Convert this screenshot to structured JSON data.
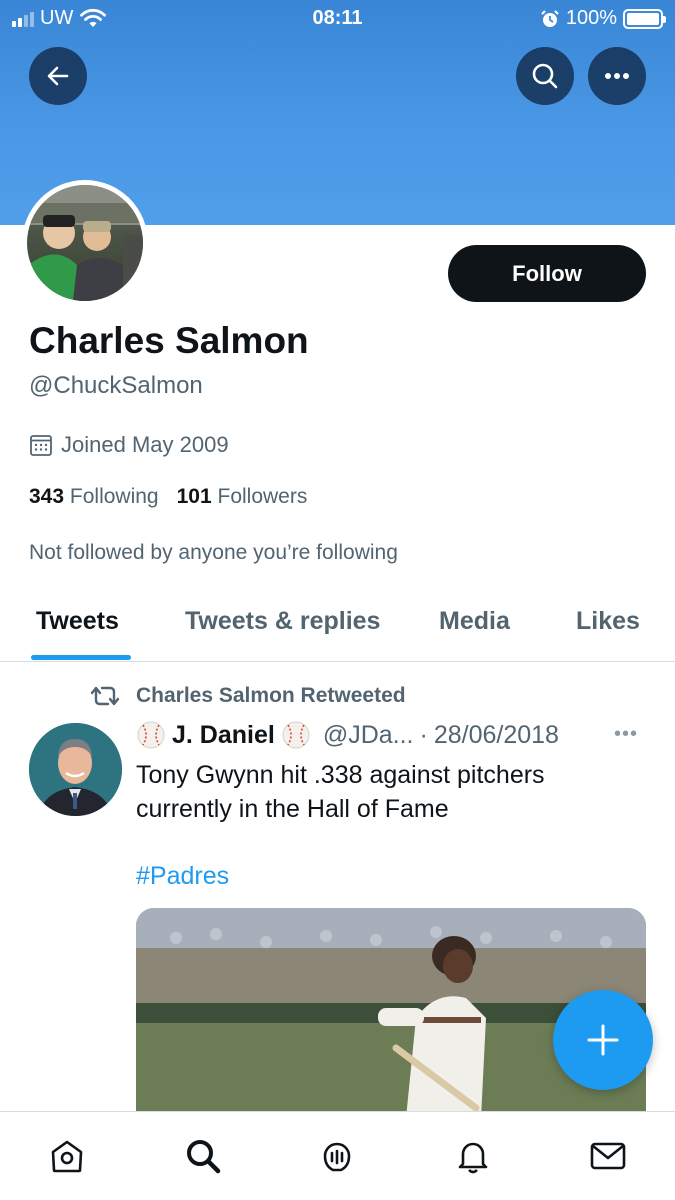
{
  "status_bar": {
    "carrier": "UW",
    "time": "08:11",
    "battery": "100%"
  },
  "header": {
    "back_icon": "arrow-left-icon",
    "search_icon": "search-icon",
    "more_icon": "more-horizontal-icon"
  },
  "profile": {
    "follow_label": "Follow",
    "name": "Charles Salmon",
    "handle": "@ChuckSalmon",
    "joined": "Joined May 2009",
    "following_count": "343",
    "following_label": "Following",
    "followers_count": "101",
    "followers_label": "Followers",
    "not_followed": "Not followed by anyone you’re following"
  },
  "tabs": [
    {
      "label": "Tweets",
      "active": true
    },
    {
      "label": "Tweets & replies",
      "active": false
    },
    {
      "label": "Media",
      "active": false
    },
    {
      "label": "Likes",
      "active": false
    }
  ],
  "tweet": {
    "retweet_label": "Charles Salmon Retweeted",
    "author": "J. Daniel",
    "handle": "@JDa...",
    "separator": "·",
    "date": "28/06/2018",
    "more": "•••",
    "text": "Tony Gwynn hit .338 against pitchers currently in the Hall of Fame",
    "hashtag": "#Padres"
  },
  "bottom_nav": [
    "home-icon",
    "search-icon",
    "spaces-icon",
    "notifications-bell-icon",
    "messages-envelope-icon"
  ],
  "colors": {
    "accent": "#1d9bf0",
    "banner": "#4a98e6",
    "text_primary": "#0f1419",
    "text_secondary": "#536471"
  }
}
